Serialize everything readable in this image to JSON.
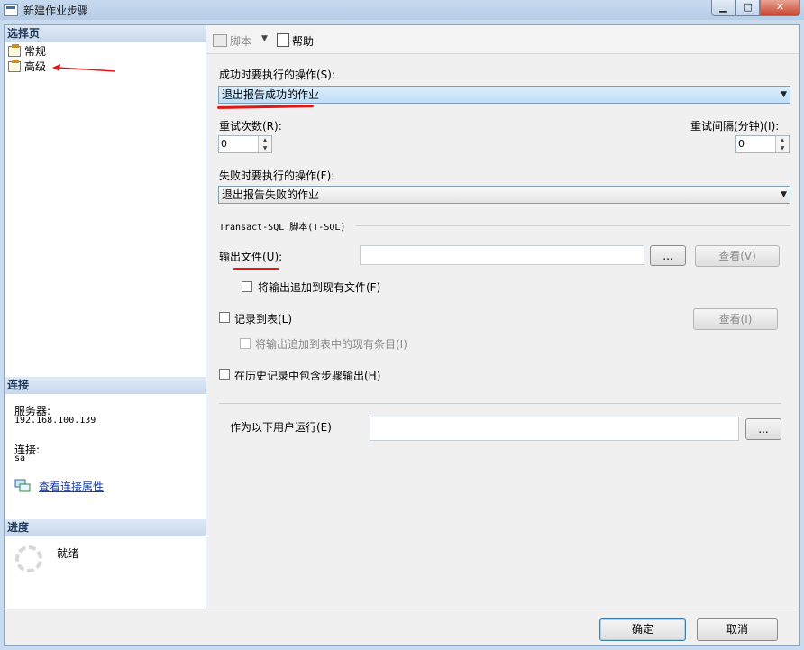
{
  "window": {
    "title": "新建作业步骤",
    "minimize": "▁",
    "maximize": "□",
    "close": "✕"
  },
  "sidebar": {
    "select_page_header": "选择页",
    "pages": [
      {
        "label": "常规"
      },
      {
        "label": "高级"
      }
    ],
    "connection_header": "连接",
    "server_label": "服务器:",
    "server_value": "192.168.100.139",
    "connection_label": "连接:",
    "connection_value": "sa",
    "view_connection_link": "查看连接属性",
    "progress_header": "进度",
    "progress_status": "就绪"
  },
  "toolbar": {
    "script_label": "脚本",
    "script_dropdown": "▼",
    "help_label": "帮助"
  },
  "form": {
    "on_success_label": "成功时要执行的操作(S):",
    "on_success_value": "退出报告成功的作业",
    "retry_attempts_label": "重试次数(R):",
    "retry_attempts_value": "0",
    "retry_interval_label": "重试间隔(分钟)(I):",
    "retry_interval_value": "0",
    "on_failure_label": "失败时要执行的操作(F):",
    "on_failure_value": "退出报告失败的作业",
    "tsql_group_label": "Transact-SQL 脚本(T-SQL)",
    "output_file_label": "输出文件(U):",
    "output_file_value": "",
    "browse_label": "...",
    "view_label_1": "查看(V)",
    "append_output_label": "将输出追加到现有文件(F)",
    "log_to_table_label": "记录到表(L)",
    "view_label_2": "查看(I)",
    "append_table_label": "将输出追加到表中的现有条目(I)",
    "include_history_label": "在历史记录中包含步骤输出(H)",
    "run_as_label": "作为以下用户运行(E)",
    "run_as_value": "",
    "run_as_browse_label": "..."
  },
  "footer": {
    "ok_label": "确定",
    "cancel_label": "取消"
  },
  "colors": {
    "annotation_red": "#e31515",
    "link_blue": "#1a3ea8"
  }
}
